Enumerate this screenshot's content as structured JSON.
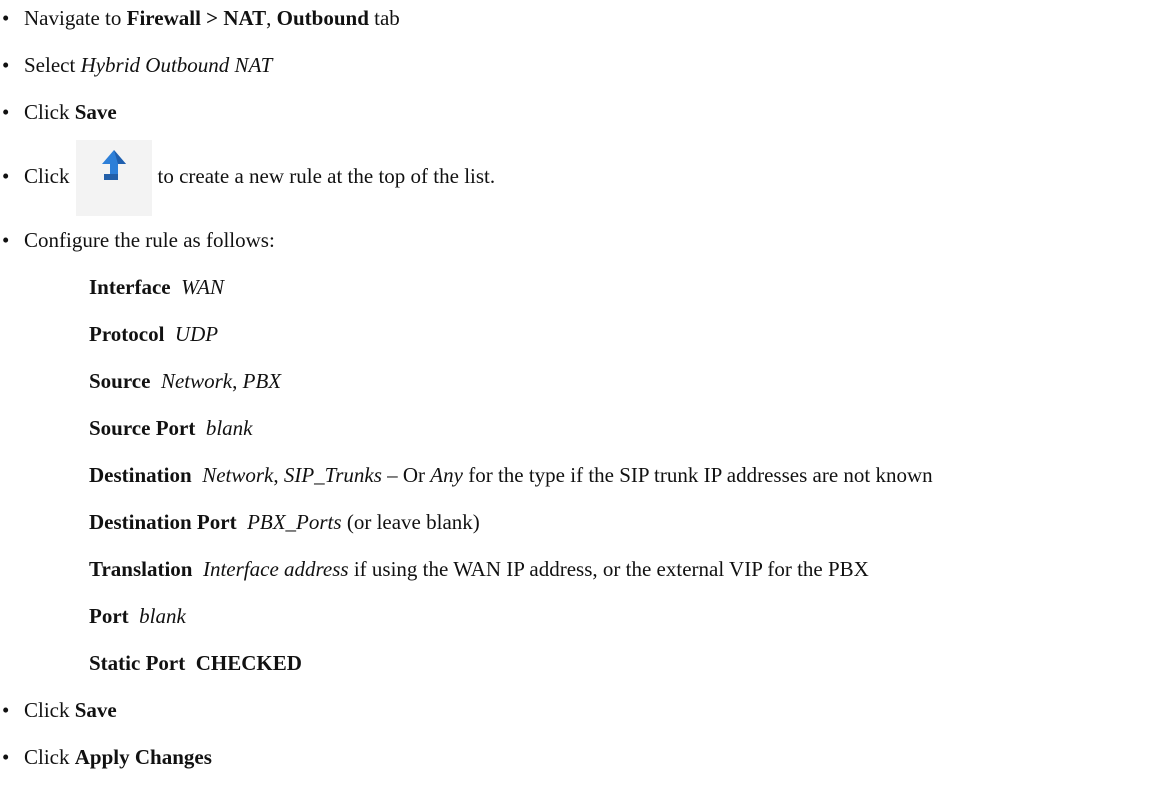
{
  "bullet_char": "•",
  "steps": {
    "s1": {
      "t1": "Navigate to ",
      "b1": "Firewall > NAT",
      "t2": ", ",
      "b2": "Outbound",
      "t3": " tab"
    },
    "s2": {
      "t1": "Select ",
      "i1": "Hybrid Outbound NAT"
    },
    "s3": {
      "t1": "Click ",
      "b1": "Save"
    },
    "s4": {
      "t1": "Click",
      "t2": "to create a new rule at the top of the list.",
      "icon": "add-rule-top-icon",
      "icon_color": "#2d7fd8"
    },
    "s5": {
      "t1": "Configure the rule as follows:"
    },
    "s6": {
      "t1": "Click ",
      "b1": "Save"
    },
    "s7": {
      "t1": "Click ",
      "b1": "Apply Changes"
    }
  },
  "rule": {
    "interface": {
      "label": "Interface",
      "value": "WAN"
    },
    "protocol": {
      "label": "Protocol",
      "value": "UDP"
    },
    "source": {
      "label": "Source",
      "v1": "Network",
      "sep": ", ",
      "v2": "PBX"
    },
    "source_port": {
      "label": "Source Port",
      "value": "blank"
    },
    "destination": {
      "label": "Destination",
      "v1": "Network",
      "sep": ", ",
      "v2": "SIP_Trunks",
      "t1": " – Or ",
      "v3": "Any",
      "t2": " for the type if the SIP trunk IP addresses are not known"
    },
    "destination_port": {
      "label": "Destination Port",
      "value": "PBX_Ports",
      "t1": " (or leave blank)"
    },
    "translation": {
      "label": "Translation",
      "value": "Interface address",
      "t1": " if using the WAN IP address, or the external VIP for the PBX"
    },
    "port": {
      "label": "Port",
      "value": "blank"
    },
    "static_port": {
      "label": "Static Port",
      "value": "CHECKED"
    }
  }
}
